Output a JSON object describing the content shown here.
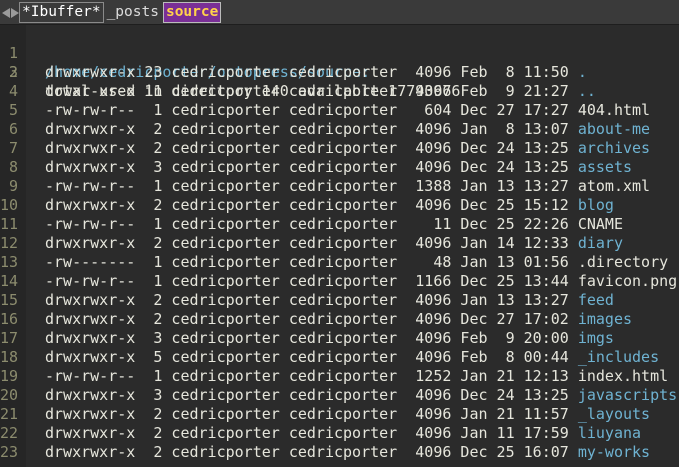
{
  "tabs": [
    {
      "label": "*Ibuffer*",
      "style": "boxed"
    },
    {
      "label": "_posts",
      "style": "plain"
    },
    {
      "label": "source",
      "style": "active"
    }
  ],
  "header": {
    "path": "/home/cedricporter/octopress/source:",
    "total": "total used in directory 140 available 17793676"
  },
  "entries": [
    {
      "num": "3",
      "prefix": "drwxrwxr-x 23 cedricporter cedricporter  4096 Feb  8 11:50 ",
      "name": ".",
      "type": "dir"
    },
    {
      "num": "4",
      "prefix": "drwxr-xr-x 11 cedricporter cedricporter  4096 Feb  9 21:27 ",
      "name": "..",
      "type": "dir"
    },
    {
      "num": "5",
      "prefix": "-rw-rw-r--  1 cedricporter cedricporter   604 Dec 27 17:27 ",
      "name": "404.html",
      "type": "file"
    },
    {
      "num": "6",
      "prefix": "drwxrwxr-x  2 cedricporter cedricporter  4096 Jan  8 13:07 ",
      "name": "about-me",
      "type": "dir"
    },
    {
      "num": "7",
      "prefix": "drwxrwxr-x  2 cedricporter cedricporter  4096 Dec 24 13:25 ",
      "name": "archives",
      "type": "dir"
    },
    {
      "num": "8",
      "prefix": "drwxrwxr-x  3 cedricporter cedricporter  4096 Dec 24 13:25 ",
      "name": "assets",
      "type": "dir"
    },
    {
      "num": "9",
      "prefix": "-rw-rw-r--  1 cedricporter cedricporter  1388 Jan 13 13:27 ",
      "name": "atom.xml",
      "type": "file"
    },
    {
      "num": "10",
      "prefix": "drwxrwxr-x  2 cedricporter cedricporter  4096 Dec 25 15:12 ",
      "name": "blog",
      "type": "dir"
    },
    {
      "num": "11",
      "prefix": "-rw-rw-r--  1 cedricporter cedricporter    11 Dec 25 22:26 ",
      "name": "CNAME",
      "type": "file"
    },
    {
      "num": "12",
      "prefix": "drwxrwxr-x  2 cedricporter cedricporter  4096 Jan 14 12:33 ",
      "name": "diary",
      "type": "dir"
    },
    {
      "num": "13",
      "prefix": "-rw-------  1 cedricporter cedricporter    48 Jan 13 01:56 ",
      "name": ".directory",
      "type": "file"
    },
    {
      "num": "14",
      "prefix": "-rw-rw-r--  1 cedricporter cedricporter  1166 Dec 25 13:44 ",
      "name": "favicon.png",
      "type": "file"
    },
    {
      "num": "15",
      "prefix": "drwxrwxr-x  2 cedricporter cedricporter  4096 Jan 13 13:27 ",
      "name": "feed",
      "type": "dir"
    },
    {
      "num": "16",
      "prefix": "drwxrwxr-x  2 cedricporter cedricporter  4096 Dec 27 17:02 ",
      "name": "images",
      "type": "dir"
    },
    {
      "num": "17",
      "prefix": "drwxrwxr-x  3 cedricporter cedricporter  4096 Feb  9 20:00 ",
      "name": "imgs",
      "type": "dir"
    },
    {
      "num": "18",
      "prefix": "drwxrwxr-x  5 cedricporter cedricporter  4096 Feb  8 00:44 ",
      "name": "_includes",
      "type": "dir"
    },
    {
      "num": "19",
      "prefix": "-rw-rw-r--  1 cedricporter cedricporter  1252 Jan 21 12:13 ",
      "name": "index.html",
      "type": "file"
    },
    {
      "num": "20",
      "prefix": "drwxrwxr-x  3 cedricporter cedricporter  4096 Dec 24 13:25 ",
      "name": "javascripts",
      "type": "dir"
    },
    {
      "num": "21",
      "prefix": "drwxrwxr-x  2 cedricporter cedricporter  4096 Jan 21 11:57 ",
      "name": "_layouts",
      "type": "dir"
    },
    {
      "num": "22",
      "prefix": "drwxrwxr-x  2 cedricporter cedricporter  4096 Jan 11 17:59 ",
      "name": "liuyana",
      "type": "dir"
    },
    {
      "num": "23",
      "prefix": "drwxrwxr-x  2 cedricporter cedricporter  4096 Dec 25 16:07 ",
      "name": "my-works",
      "type": "dir"
    }
  ],
  "colors": {
    "background": "#2b2b2b",
    "directory": "#6fb3d2",
    "file": "#e6e6dc",
    "line_number": "#8c8c6e",
    "active_tab_bg": "#7a2f96",
    "active_tab_fg": "#ffd24a"
  }
}
